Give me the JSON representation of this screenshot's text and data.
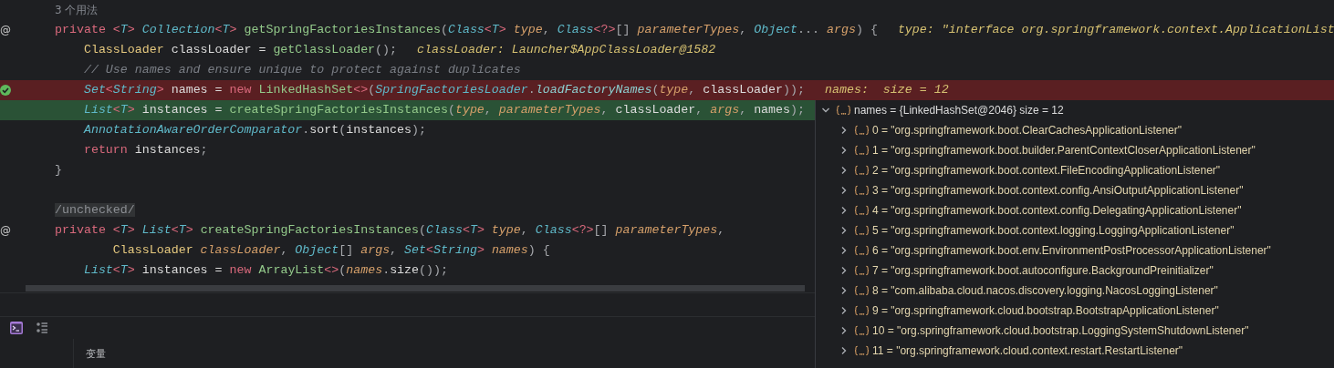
{
  "editor": {
    "lines": [
      {
        "kind": "usage",
        "text": "3 个用法"
      },
      {
        "kind": "code",
        "gutter_mark": "@",
        "breakpoint": false,
        "current": false,
        "tokens": [
          {
            "text": "private ",
            "kind": "kw"
          },
          {
            "text": "<",
            "kind": "gen"
          },
          {
            "text": "T",
            "kind": "type"
          },
          {
            "text": "> ",
            "kind": "gen"
          },
          {
            "text": "Collection",
            "kind": "type"
          },
          {
            "text": "<",
            "kind": "gen"
          },
          {
            "text": "T",
            "kind": "type"
          },
          {
            "text": "> ",
            "kind": "gen"
          },
          {
            "text": "getSpringFactoriesInstances",
            "kind": "fn"
          },
          {
            "text": "(",
            "kind": "punct"
          },
          {
            "text": "Class",
            "kind": "type"
          },
          {
            "text": "<",
            "kind": "gen"
          },
          {
            "text": "T",
            "kind": "type"
          },
          {
            "text": "> ",
            "kind": "gen"
          },
          {
            "text": "type",
            "kind": "param"
          },
          {
            "text": ", ",
            "kind": "punct"
          },
          {
            "text": "Class",
            "kind": "type"
          },
          {
            "text": "<?>",
            "kind": "gen"
          },
          {
            "text": "[] ",
            "kind": "punct"
          },
          {
            "text": "parameterTypes",
            "kind": "param"
          },
          {
            "text": ", ",
            "kind": "punct"
          },
          {
            "text": "Object",
            "kind": "type"
          },
          {
            "text": "... ",
            "kind": "punct"
          },
          {
            "text": "args",
            "kind": "param"
          },
          {
            "text": ") {",
            "kind": "punct"
          }
        ],
        "hint": "type: \"interface org.springframework.context.ApplicationList"
      },
      {
        "kind": "code",
        "breakpoint": false,
        "current": false,
        "tokens": [
          {
            "text": "    ClassLoader ",
            "kind": "cls"
          },
          {
            "text": "classLoader = ",
            "kind": "plain"
          },
          {
            "text": "getClassLoader",
            "kind": "fn"
          },
          {
            "text": "();",
            "kind": "punct"
          }
        ],
        "hint": "classLoader: Launcher$AppClassLoader@1582"
      },
      {
        "kind": "code",
        "breakpoint": false,
        "current": false,
        "tokens": [
          {
            "text": "    // Use names and ensure unique to protect against duplicates",
            "kind": "comment"
          }
        ]
      },
      {
        "kind": "code",
        "breakpoint": true,
        "current": false,
        "tokens": [
          {
            "text": "    Set",
            "kind": "type"
          },
          {
            "text": "<",
            "kind": "gen"
          },
          {
            "text": "String",
            "kind": "type"
          },
          {
            "text": "> ",
            "kind": "gen"
          },
          {
            "text": "names = ",
            "kind": "plain"
          },
          {
            "text": "new ",
            "kind": "kw"
          },
          {
            "text": "LinkedHashSet",
            "kind": "fn"
          },
          {
            "text": "<>",
            "kind": "gen"
          },
          {
            "text": "(",
            "kind": "punct"
          },
          {
            "text": "SpringFactoriesLoader",
            "kind": "type"
          },
          {
            "text": ".",
            "kind": "punct"
          },
          {
            "text": "loadFactoryNames",
            "kind": "static"
          },
          {
            "text": "(",
            "kind": "punct"
          },
          {
            "text": "type",
            "kind": "param"
          },
          {
            "text": ", ",
            "kind": "punct"
          },
          {
            "text": "classLoader",
            "kind": "plain"
          },
          {
            "text": "));",
            "kind": "punct"
          }
        ],
        "hint": "names:  size = 12"
      },
      {
        "kind": "code",
        "breakpoint": false,
        "current": true,
        "tokens": [
          {
            "text": "    List",
            "kind": "type"
          },
          {
            "text": "<",
            "kind": "gen"
          },
          {
            "text": "T",
            "kind": "type"
          },
          {
            "text": "> ",
            "kind": "gen"
          },
          {
            "text": "instances = ",
            "kind": "plain"
          },
          {
            "text": "createSpringFactoriesInstances",
            "kind": "fn"
          },
          {
            "text": "(",
            "kind": "punct"
          },
          {
            "text": "type",
            "kind": "param"
          },
          {
            "text": ", ",
            "kind": "punct"
          },
          {
            "text": "parameterTypes",
            "kind": "param"
          },
          {
            "text": ", ",
            "kind": "punct"
          },
          {
            "text": "classLoader",
            "kind": "plain"
          },
          {
            "text": ", ",
            "kind": "punct"
          },
          {
            "text": "args",
            "kind": "param"
          },
          {
            "text": ", ",
            "kind": "punct"
          },
          {
            "text": "names",
            "kind": "plain"
          },
          {
            "text": ");",
            "kind": "punct"
          }
        ]
      },
      {
        "kind": "code",
        "breakpoint": false,
        "current": false,
        "tokens": [
          {
            "text": "    AnnotationAwareOrderComparator",
            "kind": "type"
          },
          {
            "text": ".",
            "kind": "punct"
          },
          {
            "text": "sort",
            "kind": "plain"
          },
          {
            "text": "(",
            "kind": "punct"
          },
          {
            "text": "instances",
            "kind": "plain"
          },
          {
            "text": ");",
            "kind": "punct"
          }
        ]
      },
      {
        "kind": "code",
        "breakpoint": false,
        "current": false,
        "tokens": [
          {
            "text": "    return ",
            "kind": "kw"
          },
          {
            "text": "instances",
            "kind": "plain"
          },
          {
            "text": ";",
            "kind": "punct"
          }
        ]
      },
      {
        "kind": "code",
        "breakpoint": false,
        "current": false,
        "tokens": [
          {
            "text": "}",
            "kind": "punct"
          }
        ]
      },
      {
        "kind": "blank"
      },
      {
        "kind": "code",
        "breakpoint": false,
        "current": false,
        "tokens": [
          {
            "text": "/unchecked/",
            "kind": "muted"
          }
        ]
      },
      {
        "kind": "code",
        "gutter_mark": "@",
        "breakpoint": false,
        "current": false,
        "tokens": [
          {
            "text": "private ",
            "kind": "kw"
          },
          {
            "text": "<",
            "kind": "gen"
          },
          {
            "text": "T",
            "kind": "type"
          },
          {
            "text": "> ",
            "kind": "gen"
          },
          {
            "text": "List",
            "kind": "type"
          },
          {
            "text": "<",
            "kind": "gen"
          },
          {
            "text": "T",
            "kind": "type"
          },
          {
            "text": "> ",
            "kind": "gen"
          },
          {
            "text": "createSpringFactoriesInstances",
            "kind": "fn"
          },
          {
            "text": "(",
            "kind": "punct"
          },
          {
            "text": "Class",
            "kind": "type"
          },
          {
            "text": "<",
            "kind": "gen"
          },
          {
            "text": "T",
            "kind": "type"
          },
          {
            "text": "> ",
            "kind": "gen"
          },
          {
            "text": "type",
            "kind": "param"
          },
          {
            "text": ", ",
            "kind": "punct"
          },
          {
            "text": "Class",
            "kind": "type"
          },
          {
            "text": "<?>",
            "kind": "gen"
          },
          {
            "text": "[] ",
            "kind": "punct"
          },
          {
            "text": "parameterTypes",
            "kind": "param"
          },
          {
            "text": ",",
            "kind": "punct"
          }
        ]
      },
      {
        "kind": "code",
        "breakpoint": false,
        "current": false,
        "tokens": [
          {
            "text": "        ClassLoader ",
            "kind": "cls"
          },
          {
            "text": "classLoader",
            "kind": "param"
          },
          {
            "text": ", ",
            "kind": "punct"
          },
          {
            "text": "Object",
            "kind": "type"
          },
          {
            "text": "[] ",
            "kind": "punct"
          },
          {
            "text": "args",
            "kind": "param"
          },
          {
            "text": ", ",
            "kind": "punct"
          },
          {
            "text": "Set",
            "kind": "type"
          },
          {
            "text": "<",
            "kind": "gen"
          },
          {
            "text": "String",
            "kind": "type"
          },
          {
            "text": "> ",
            "kind": "gen"
          },
          {
            "text": "names",
            "kind": "param"
          },
          {
            "text": ") {",
            "kind": "punct"
          }
        ]
      },
      {
        "kind": "code",
        "breakpoint": false,
        "current": false,
        "tokens": [
          {
            "text": "    List",
            "kind": "type"
          },
          {
            "text": "<",
            "kind": "gen"
          },
          {
            "text": "T",
            "kind": "type"
          },
          {
            "text": "> ",
            "kind": "gen"
          },
          {
            "text": "instances = ",
            "kind": "plain"
          },
          {
            "text": "new ",
            "kind": "kw"
          },
          {
            "text": "ArrayList",
            "kind": "fn"
          },
          {
            "text": "<>",
            "kind": "gen"
          },
          {
            "text": "(",
            "kind": "punct"
          },
          {
            "text": "names",
            "kind": "param"
          },
          {
            "text": ".",
            "kind": "punct"
          },
          {
            "text": "size",
            "kind": "plain"
          },
          {
            "text": "());",
            "kind": "punct"
          }
        ]
      }
    ]
  },
  "bottom_panel": {
    "tab_label": "变量"
  },
  "debug_popup": {
    "root": {
      "text": "names = {LinkedHashSet@2046}  size = 12",
      "expanded": true,
      "children": [
        {
          "text": "0 = \"org.springframework.boot.ClearCachesApplicationListener\"",
          "expanded": false
        },
        {
          "text": "1 = \"org.springframework.boot.builder.ParentContextCloserApplicationListener\"",
          "expanded": false
        },
        {
          "text": "2 = \"org.springframework.boot.context.FileEncodingApplicationListener\"",
          "expanded": false
        },
        {
          "text": "3 = \"org.springframework.boot.context.config.AnsiOutputApplicationListener\"",
          "expanded": false
        },
        {
          "text": "4 = \"org.springframework.boot.context.config.DelegatingApplicationListener\"",
          "expanded": false
        },
        {
          "text": "5 = \"org.springframework.boot.context.logging.LoggingApplicationListener\"",
          "expanded": false
        },
        {
          "text": "6 = \"org.springframework.boot.env.EnvironmentPostProcessorApplicationListener\"",
          "expanded": false
        },
        {
          "text": "7 = \"org.springframework.boot.autoconfigure.BackgroundPreinitializer\"",
          "expanded": false
        },
        {
          "text": "8 = \"com.alibaba.cloud.nacos.discovery.logging.NacosLoggingListener\"",
          "expanded": false
        },
        {
          "text": "9 = \"org.springframework.cloud.bootstrap.BootstrapApplicationListener\"",
          "expanded": false
        },
        {
          "text": "10 = \"org.springframework.cloud.bootstrap.LoggingSystemShutdownListener\"",
          "expanded": false
        },
        {
          "text": "11 = \"org.springframework.cloud.context.restart.RestartListener\"",
          "expanded": false
        }
      ]
    }
  }
}
